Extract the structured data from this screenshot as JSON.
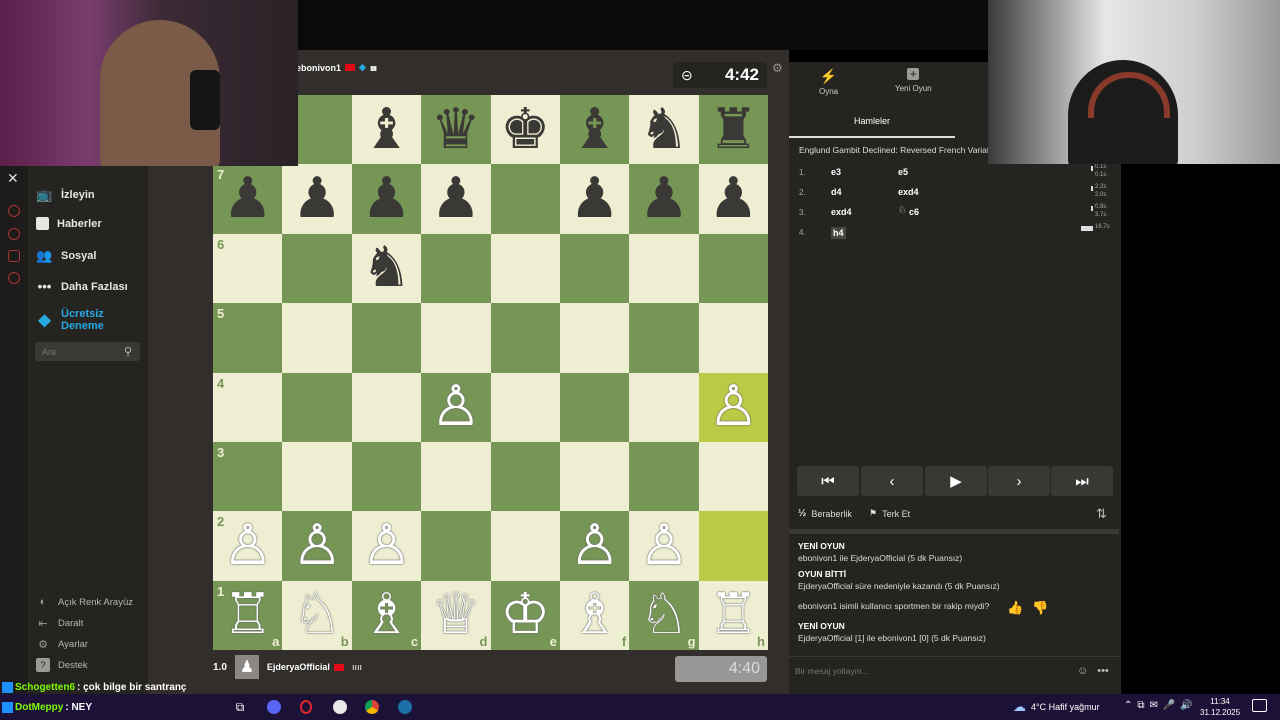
{
  "sidebar": {
    "items": [
      {
        "label": "İzleyin",
        "icon": "tv-icon"
      },
      {
        "label": "Haberler",
        "icon": "news-icon"
      },
      {
        "label": "Sosyal",
        "icon": "people-icon"
      },
      {
        "label": "Daha Fazlası",
        "icon": "more-icon"
      }
    ],
    "premium_line1": "Ücretsiz",
    "premium_line2": "Deneme",
    "search_placeholder": "Ara",
    "bottom": [
      {
        "label": "Açık Renk Arayüz",
        "icon": "theme-icon"
      },
      {
        "label": "Daralt",
        "icon": "collapse-icon"
      },
      {
        "label": "Ayarlar",
        "icon": "settings-icon"
      },
      {
        "label": "Destek",
        "icon": "help-icon"
      }
    ]
  },
  "opponent": {
    "name": "ebonivon1",
    "clock": "4:42"
  },
  "player": {
    "rating": "1.0",
    "name": "EjderyaOfficial",
    "clock": "4:40"
  },
  "board": {
    "ranks": [
      "7",
      "6",
      "5",
      "4",
      "3",
      "2",
      "1"
    ],
    "files": [
      "a",
      "b",
      "c",
      "d",
      "e",
      "f",
      "g",
      "h"
    ],
    "rows": [
      [
        "",
        "",
        "bB",
        "bQ",
        "bK",
        "bB",
        "bN",
        "bR"
      ],
      [
        "bP",
        "bP",
        "bP",
        "bP",
        "",
        "bP",
        "bP",
        "bP"
      ],
      [
        "",
        "",
        "bN",
        "",
        "",
        "",
        "",
        ""
      ],
      [
        "",
        "",
        "",
        "",
        "",
        "",
        "",
        ""
      ],
      [
        "",
        "",
        "",
        "wP",
        "",
        "",
        "",
        "wP"
      ],
      [
        "",
        "",
        "",
        "",
        "",
        "",
        "",
        ""
      ],
      [
        "wP",
        "wP",
        "wP",
        "",
        "",
        "wP",
        "wP",
        ""
      ],
      [
        "wR",
        "wN",
        "wB",
        "wQ",
        "wK",
        "wB",
        "wN",
        "wR"
      ]
    ],
    "highlight": [
      "h4",
      "h2"
    ]
  },
  "panel": {
    "tabs": [
      {
        "label": "Oyna",
        "icon": "bolt-icon"
      },
      {
        "label": "Yeni Oyun",
        "icon": "plus-icon"
      }
    ],
    "section_tab": "Hamleler",
    "opening": "Englund Gambit Declined: Reversed French Variat",
    "moves": [
      {
        "num": "1.",
        "white": "e3",
        "black": "e5",
        "tw": "0.1s",
        "tb": "0.1s"
      },
      {
        "num": "2.",
        "white": "d4",
        "black": "exd4",
        "tw": "2.2s",
        "tb": "2.0s"
      },
      {
        "num": "3.",
        "white": "exd4",
        "black": "c6",
        "tw": "0.8s",
        "tb": "3.7s"
      },
      {
        "num": "4.",
        "white": "h4",
        "black": "",
        "tw": "16.7s",
        "tb": ""
      }
    ],
    "draw": "Beraberlik",
    "resign": "Terk Et",
    "chat": {
      "new_game_title": "YENİ OYUN",
      "new_game_text1": "ebonivon1 ile EjderyaOfficial (5 dk Puansız)",
      "game_over_title": "OYUN BİTTİ",
      "game_over_text": "EjderyaOfficial süre nedeniyle kazandı (5 dk Puansız)",
      "question": "ebonivon1 isimli kullanıcı sportmen bir rakip miydi?",
      "new_game_title2": "YENİ OYUN",
      "new_game_text2": "EjderyaOfficial [1] ile ebonivon1 [0] (5 dk Puansız)",
      "placeholder": "Bir mesaj yollayın..."
    }
  },
  "stream_chat": [
    {
      "user": "Schogetten6",
      "text": ": çok bilge bir santranç"
    },
    {
      "user": "DotMeppy",
      "text": ": NEY"
    }
  ],
  "taskbar": {
    "weather": "4°C  Hafif yağmur",
    "time": "11:34",
    "date": "31.12.2025"
  },
  "colors": {
    "board_light": "#eeeed2",
    "board_dark": "#769656",
    "highlight": "#baca44",
    "premium": "#27a9e1"
  }
}
